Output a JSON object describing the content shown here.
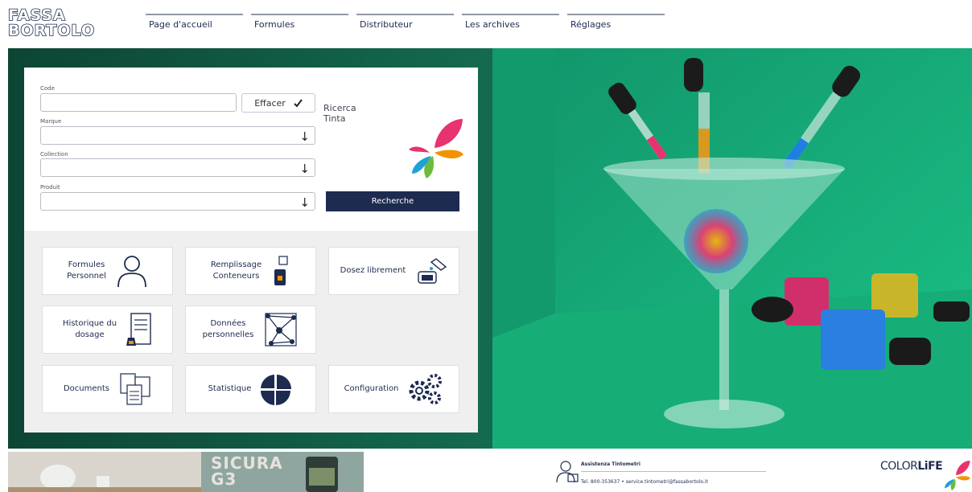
{
  "header": {
    "logo_line1": "FASSA",
    "logo_line2": "BORTOLO",
    "nav": [
      "Page d'accueil",
      "Formules",
      "Distributeur",
      "Les archives",
      "Réglages"
    ]
  },
  "search": {
    "code_label": "Code",
    "clear_label": "Effacer",
    "marque_label": "Marque",
    "collection_label": "Collection",
    "produit_label": "Produit",
    "ricerca_line1": "Ricerca",
    "ricerca_line2": "Tinta",
    "search_label": "Recherche"
  },
  "tiles": [
    {
      "label_line1": "Formules",
      "label_line2": "Personnel",
      "icon": "person-icon"
    },
    {
      "label_line1": "Remplissage",
      "label_line2": "Conteneurs",
      "icon": "container-fill-icon"
    },
    {
      "label_line1": "Dosez librement",
      "label_line2": "",
      "icon": "dosing-icon"
    },
    {
      "label_line1": "Historique du",
      "label_line2": "dosage",
      "icon": "history-document-icon"
    },
    {
      "label_line1": "Données",
      "label_line2": "personnelles",
      "icon": "network-icon"
    },
    {
      "label_line1": "Documents",
      "label_line2": "",
      "icon": "documents-icon"
    },
    {
      "label_line1": "Statistique",
      "label_line2": "",
      "icon": "pie-chart-icon"
    },
    {
      "label_line1": "Configuration",
      "label_line2": "",
      "icon": "gears-icon"
    }
  ],
  "footer": {
    "banner_line1": "SICURA",
    "banner_line2": "G3",
    "assist_title": "Assistenza Tintometri",
    "assist_contact": "Tel. 800-353637  •  service.tintometri@fassabortolo.it",
    "brand_a": "COLOR",
    "brand_b": "LiFE"
  },
  "colors": {
    "navy": "#1c2b4f",
    "hero_green": "#10503f",
    "room_green": "#18b07a",
    "petal_pink": "#e8336f",
    "petal_orange": "#f39200",
    "petal_green": "#6dbb3c",
    "petal_blue": "#1fa2dc"
  }
}
